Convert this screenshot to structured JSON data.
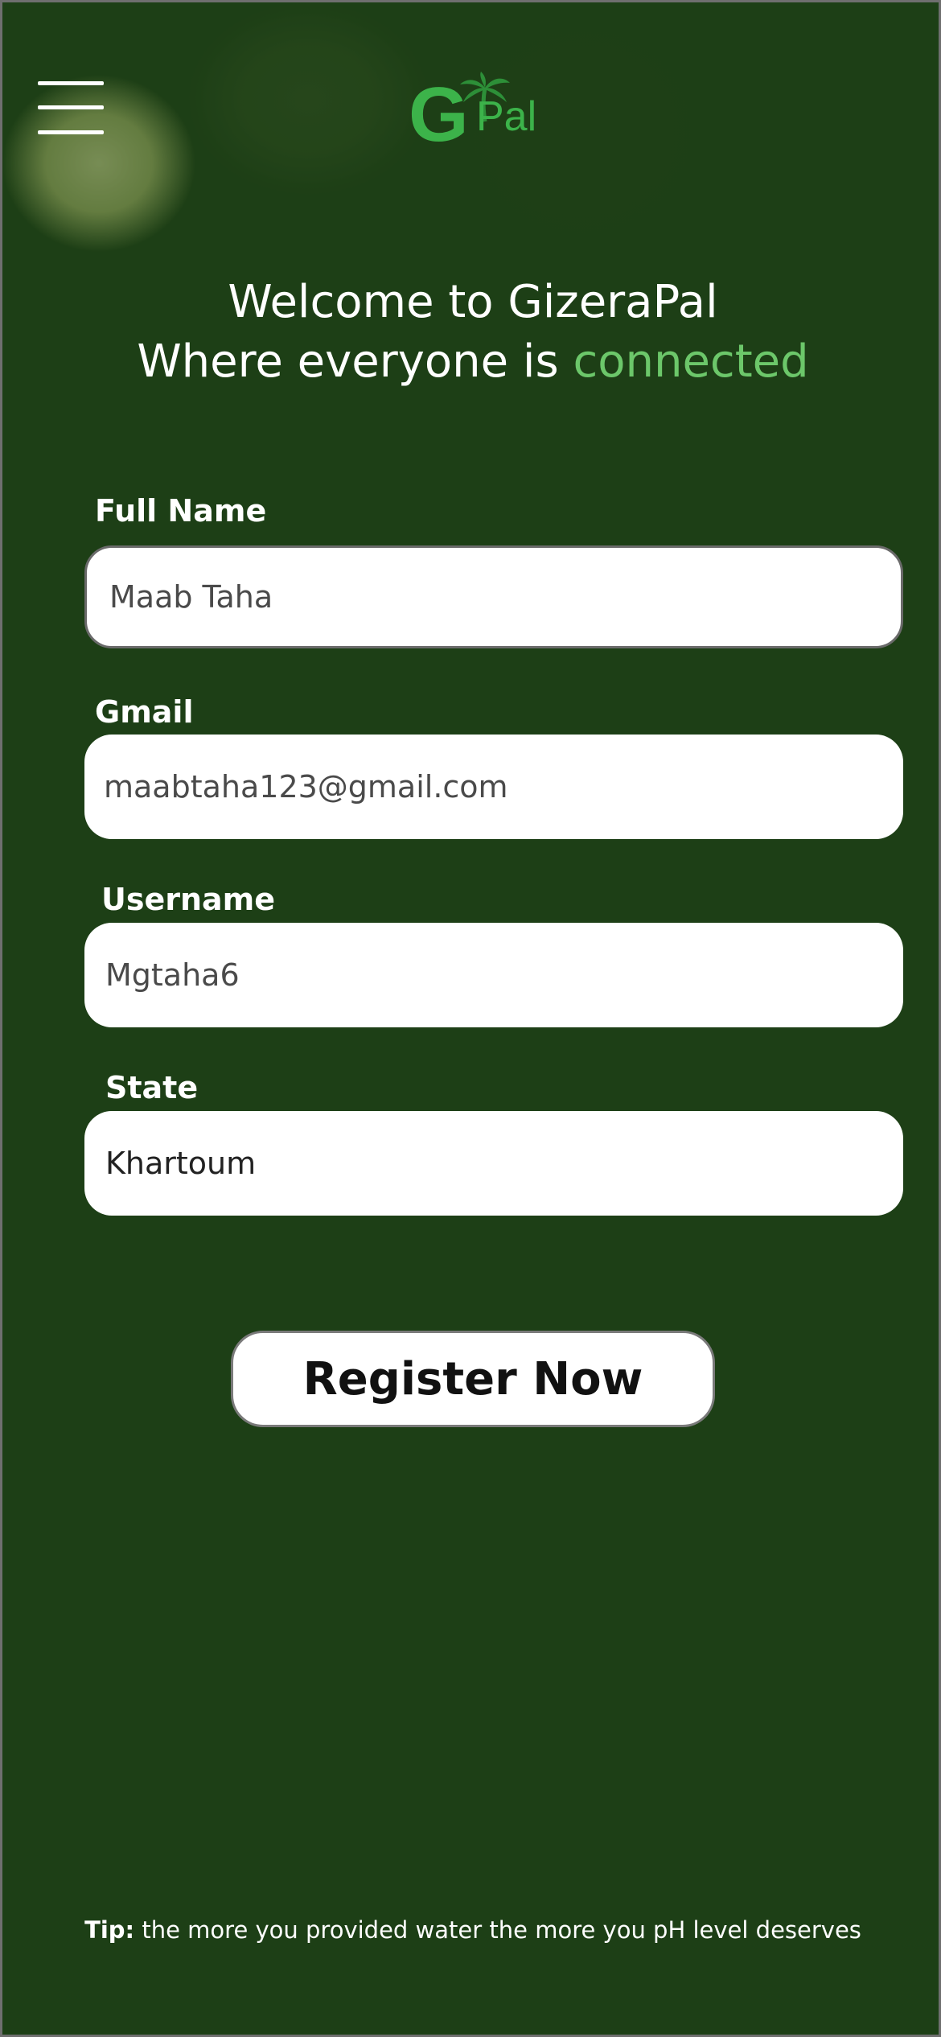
{
  "header": {
    "logo_letter": "G",
    "logo_suffix": "Pal",
    "menu_icon": "hamburger-menu-icon",
    "brand_color": "#3cb34a"
  },
  "welcome": {
    "line1": "Welcome to GizeraPal",
    "line2_prefix": "Where everyone is ",
    "line2_accent": "connected",
    "accent_color": "#6cc76a"
  },
  "form": {
    "full_name": {
      "label": "Full Name",
      "value": "Maab Taha"
    },
    "gmail": {
      "label": "Gmail",
      "value": "maabtaha123@gmail.com"
    },
    "username": {
      "label": "Username",
      "value": "Mgtaha6"
    },
    "state": {
      "label": "State",
      "value": "Khartoum"
    },
    "submit_label": "Register Now"
  },
  "footer": {
    "tip_label": "Tip:",
    "tip_text": " the more you provided water the more you pH level deserves"
  }
}
